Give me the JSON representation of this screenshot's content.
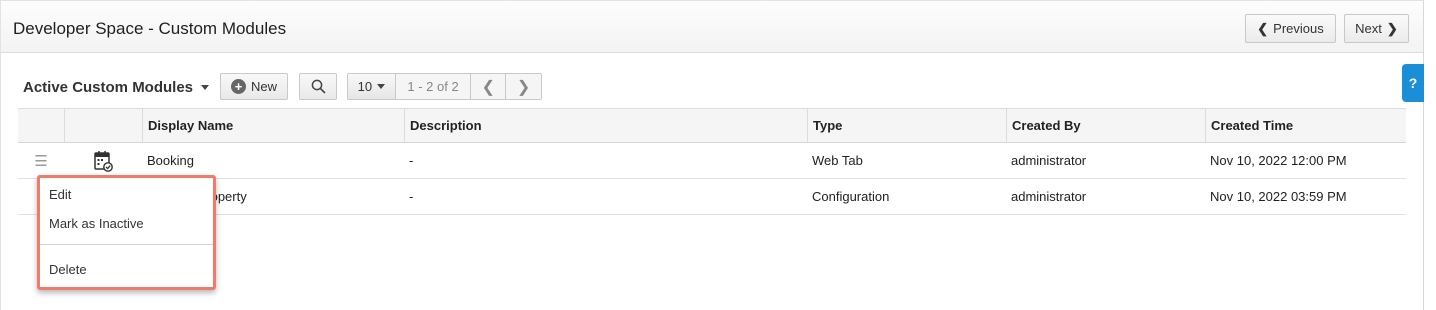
{
  "header": {
    "title": "Developer Space - Custom Modules",
    "previous_label": "Previous",
    "next_label": "Next"
  },
  "toolbar": {
    "view_label": "Active Custom Modules",
    "new_label": "New",
    "page_size": "10",
    "range": "1 - 2 of 2"
  },
  "table": {
    "columns": [
      "Display Name",
      "Description",
      "Type",
      "Created By",
      "Created Time"
    ],
    "rows": [
      {
        "display_name": "Booking",
        "description": "-",
        "type": "Web Tab",
        "created_by": "administrator",
        "created_time": "Nov 10, 2022 12:00 PM",
        "icon": "calendar-check-icon"
      },
      {
        "display_name": "Booking Property",
        "description": "-",
        "type": "Configuration",
        "created_by": "administrator",
        "created_time": "Nov 10, 2022 03:59 PM"
      }
    ]
  },
  "context_menu": {
    "items": [
      "Edit",
      "Mark as Inactive",
      "Delete"
    ],
    "highlight_color": "#ee7b6b"
  },
  "help": {
    "label": "?"
  },
  "colors": {
    "accent": "#1a8fd8"
  }
}
